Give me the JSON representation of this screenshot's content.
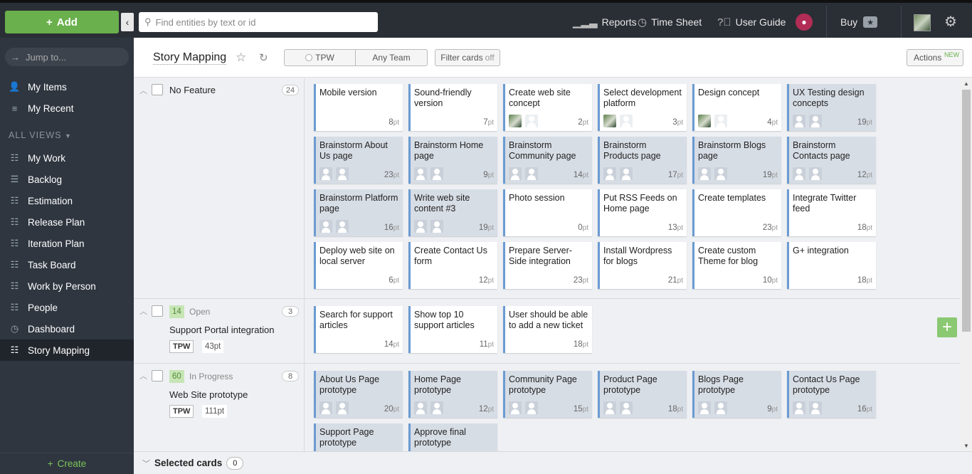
{
  "topbar": {
    "add_label": "Add",
    "search_placeholder": "Find entities by text or id",
    "reports": "Reports",
    "timesheet": "Time Sheet",
    "userguide": "User Guide",
    "buy": "Buy"
  },
  "sidebar": {
    "jump_placeholder": "Jump to...",
    "my_items": "My Items",
    "my_recent": "My Recent",
    "all_views": "ALL VIEWS",
    "items": [
      {
        "label": "My Work"
      },
      {
        "label": "Backlog"
      },
      {
        "label": "Estimation"
      },
      {
        "label": "Release Plan"
      },
      {
        "label": "Iteration Plan"
      },
      {
        "label": "Task Board"
      },
      {
        "label": "Work by Person"
      },
      {
        "label": "People"
      },
      {
        "label": "Dashboard"
      },
      {
        "label": "Story Mapping"
      }
    ],
    "create": "Create"
  },
  "header": {
    "title": "Story Mapping",
    "team_project": "TPW",
    "team": "Any Team",
    "filter": "Filter cards",
    "filter_state": "off",
    "actions": "Actions",
    "actions_badge": "NEW"
  },
  "lanes": [
    {
      "name": "No Feature",
      "count": "24",
      "cards": [
        {
          "title": "Mobile version",
          "pt": "8"
        },
        {
          "title": "Sound-friendly version",
          "pt": "7"
        },
        {
          "title": "Create web site concept",
          "pt": "2"
        },
        {
          "title": "Select development platform",
          "pt": "3"
        },
        {
          "title": "Design concept",
          "pt": "4"
        },
        {
          "title": "UX Testing design concepts",
          "pt": "19"
        },
        {
          "title": "Brainstorm About Us page",
          "pt": "23"
        },
        {
          "title": "Brainstorm Home page",
          "pt": "9"
        },
        {
          "title": "Brainstorm Community page",
          "pt": "14"
        },
        {
          "title": "Brainstorm Products page",
          "pt": "17"
        },
        {
          "title": "Brainstorm Blogs page",
          "pt": "19"
        },
        {
          "title": "Brainstorm Contacts page",
          "pt": "12"
        },
        {
          "title": "Brainstorm Platform page",
          "pt": "16"
        },
        {
          "title": "Write web site content #3",
          "pt": "19"
        },
        {
          "title": "Photo session",
          "pt": "0"
        },
        {
          "title": "Put RSS Feeds on Home page",
          "pt": "13"
        },
        {
          "title": "Create templates",
          "pt": "23"
        },
        {
          "title": "Integrate Twitter feed",
          "pt": "18"
        },
        {
          "title": "Deploy web site on local server",
          "pt": "6"
        },
        {
          "title": "Create Contact Us form",
          "pt": "12"
        },
        {
          "title": "Prepare Server-Side integration",
          "pt": "23"
        },
        {
          "title": "Install Wordpress for blogs",
          "pt": "21"
        },
        {
          "title": "Create custom Theme for blog",
          "pt": "10"
        },
        {
          "title": "G+ integration",
          "pt": "18"
        }
      ]
    },
    {
      "effort": "14",
      "state": "Open",
      "count": "3",
      "name": "Support Portal integration",
      "tag": "TPW",
      "points": "43pt",
      "cards": [
        {
          "title": "Search for support articles",
          "pt": "14"
        },
        {
          "title": "Show top 10 support articles",
          "pt": "11"
        },
        {
          "title": "User should be able to add a new ticket",
          "pt": "18"
        }
      ]
    },
    {
      "effort": "60",
      "state": "In Progress",
      "count": "8",
      "name": "Web Site prototype",
      "tag": "TPW",
      "points": "111pt",
      "cards": [
        {
          "title": "About Us Page prototype",
          "pt": "20"
        },
        {
          "title": "Home Page prototype",
          "pt": "12"
        },
        {
          "title": "Community Page prototype",
          "pt": "15"
        },
        {
          "title": "Product Page prototype",
          "pt": "18"
        },
        {
          "title": "Blogs Page prototype",
          "pt": "9"
        },
        {
          "title": "Contact Us Page prototype",
          "pt": "16"
        },
        {
          "title": "Support Page prototype",
          "pt": ""
        },
        {
          "title": "Approve final prototype",
          "pt": ""
        }
      ]
    }
  ],
  "pt_unit": "pt",
  "selected": {
    "label": "Selected cards",
    "count": "0"
  },
  "colors": {
    "accent_green": "#6ab04c",
    "card_border": "#6b9bd2",
    "sidebar_bg": "#2f3640",
    "user_avatar": "#b22d55"
  }
}
